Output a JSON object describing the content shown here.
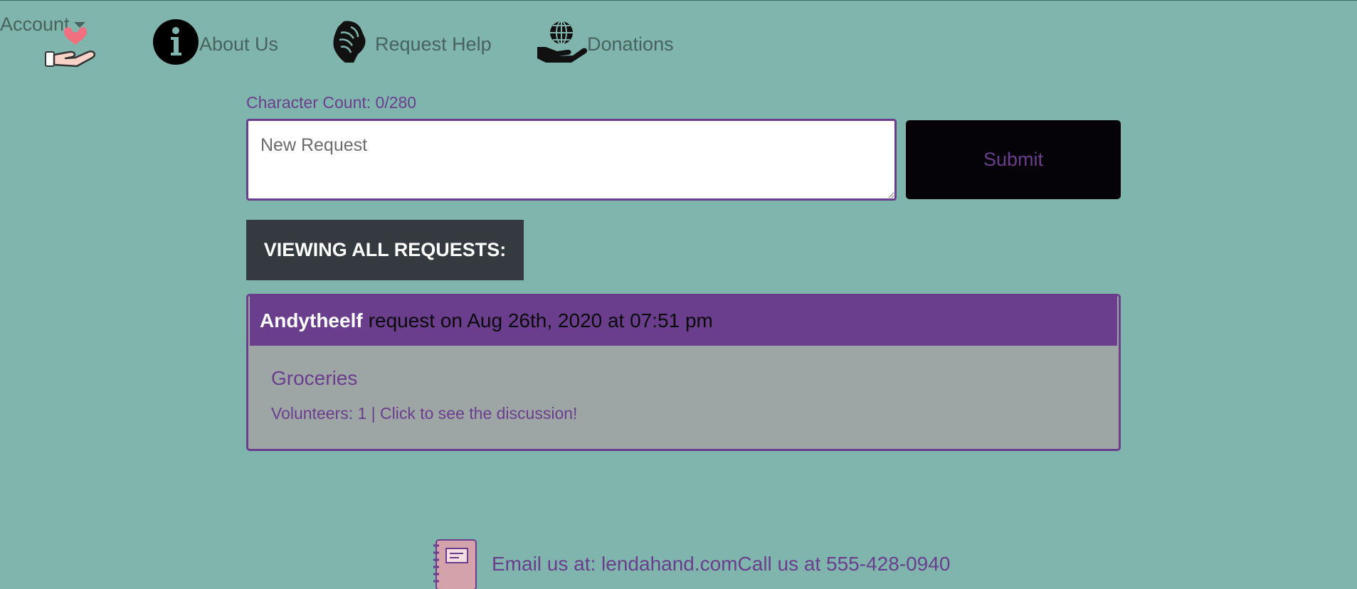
{
  "nav": {
    "brand_icon": "heart-hand-logo",
    "items": [
      {
        "label": "About Us",
        "icon": "info-icon"
      },
      {
        "label": "Request Help",
        "icon": "handshake-icon"
      },
      {
        "label": "Donations",
        "icon": "globe-hand-icon"
      }
    ],
    "account_label": "Account"
  },
  "form": {
    "char_count": "Character Count: 0/280",
    "placeholder": "New Request",
    "submit_label": "Submit"
  },
  "viewing_label": "VIEWING ALL REQUESTS:",
  "requests": [
    {
      "user": "Andytheelf",
      "meta": "request on Aug 26th, 2020 at 07:51 pm",
      "title": "Groceries",
      "volunteers": "Volunteers: 1 | Click to see the discussion!"
    }
  ],
  "footer": {
    "icon": "notebook-icon",
    "text": "Email us at: lendahand.comCall us at 555-428-0940"
  },
  "colors": {
    "background": "#80b5ad",
    "accent": "#6a3e8d",
    "dark": "#343a40"
  }
}
